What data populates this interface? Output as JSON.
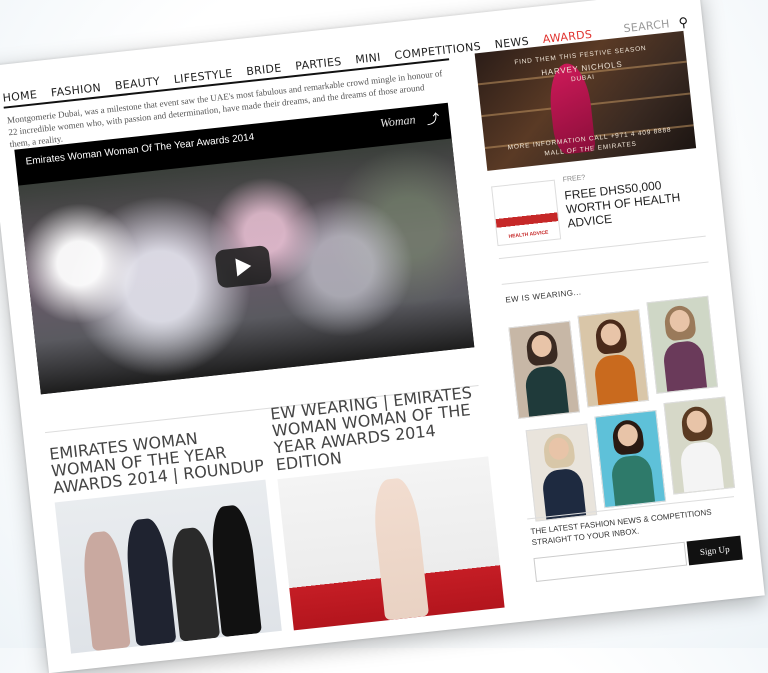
{
  "nav": {
    "items": [
      "HOME",
      "FASHION",
      "BEAUTY",
      "LIFESTYLE",
      "BRIDE",
      "PARTIES",
      "MINI",
      "COMPETITIONS",
      "NEWS",
      "AWARDS"
    ],
    "active": "AWARDS",
    "search_placeholder": "SEARCH",
    "search_icon": "magnifier-icon"
  },
  "intro_text": "Montgomerie Dubai, was a milestone that event saw the UAE's most fabulous and remarkable crowd mingle in honour of 22 incredible women who, with passion and determination, have made their dreams, and the dreams of those around them, a reality.",
  "video": {
    "title": "Emirates Woman Woman Of The Year Awards 2014",
    "logo": "Woman",
    "icons": [
      "share-icon",
      "play-icon"
    ]
  },
  "articles": [
    {
      "title": "EMIRATES WOMAN WOMAN OF THE YEAR AWARDS 2014 | ROUNDUP"
    },
    {
      "title": "EW WEARING | EMIRATES WOMAN WOMAN OF THE YEAR AWARDS 2014 EDITION"
    }
  ],
  "sidebar": {
    "ad": {
      "top_text": "FIND THEM THIS FESTIVE SEASON",
      "brand": "HARVEY NICHOLS",
      "brand_sub": "DUBAI",
      "bottom_text": "MORE INFORMATION CALL +971 4 409 8888",
      "bottom_text2": "MALL OF THE EMIRATES"
    },
    "promo": {
      "thumb_caption": "HEALTH ADVICE",
      "label": "FREE?",
      "title": "FREE DHS50,000 WORTH OF HEALTH ADVICE"
    },
    "wearing_title": "EW IS WEARING...",
    "newsletter_text": "THE LATEST FASHION NEWS & COMPETITIONS STRAIGHT TO YOUR INBOX.",
    "signup_label": "Sign Up"
  },
  "colors": {
    "accent": "#e0322e",
    "nav_text": "#222222",
    "video_bg": "#000000",
    "signup_bg": "#111111"
  }
}
